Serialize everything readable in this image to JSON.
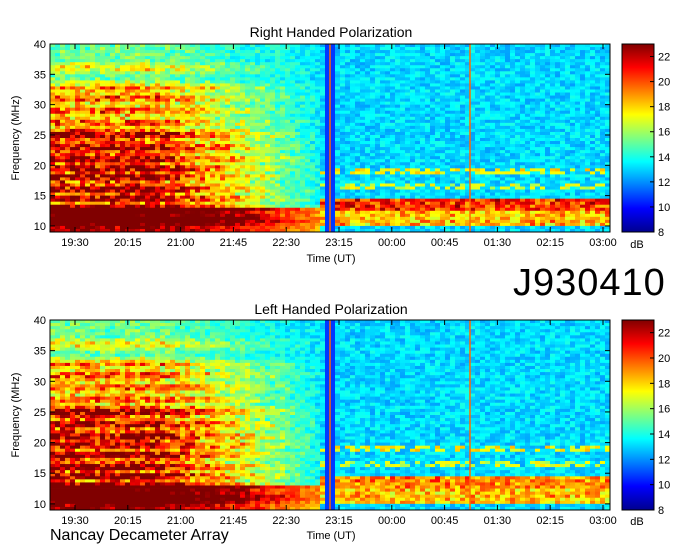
{
  "date_label": "J930410",
  "footer": "Nancay Decameter Array",
  "chart_data": [
    {
      "type": "heatmap",
      "title": "Right Handed Polarization",
      "xlabel": "Time (UT)",
      "ylabel": "Frequency (MHz)",
      "x_ticks": [
        "19:30",
        "20:15",
        "21:00",
        "21:45",
        "22:30",
        "23:15",
        "00:00",
        "00:45",
        "01:30",
        "02:15",
        "03:00"
      ],
      "y_ticks": [
        "10",
        "15",
        "20",
        "25",
        "30",
        "35",
        "40"
      ],
      "ylim": [
        9,
        40
      ],
      "colorbar": {
        "label": "dB",
        "ticks": [
          "8",
          "10",
          "12",
          "14",
          "16",
          "18",
          "20",
          "22"
        ],
        "range": [
          8,
          23
        ]
      }
    },
    {
      "type": "heatmap",
      "title": "Left Handed Polarization",
      "xlabel": "Time (UT)",
      "ylabel": "Frequency (MHz)",
      "x_ticks": [
        "19:30",
        "20:15",
        "21:00",
        "21:45",
        "22:30",
        "23:15",
        "00:00",
        "00:45",
        "01:30",
        "02:15",
        "03:00"
      ],
      "y_ticks": [
        "10",
        "15",
        "20",
        "25",
        "30",
        "35",
        "40"
      ],
      "ylim": [
        9,
        40
      ],
      "colorbar": {
        "label": "dB",
        "ticks": [
          "8",
          "10",
          "12",
          "14",
          "16",
          "18",
          "20",
          "22"
        ],
        "range": [
          8,
          23
        ]
      }
    }
  ]
}
